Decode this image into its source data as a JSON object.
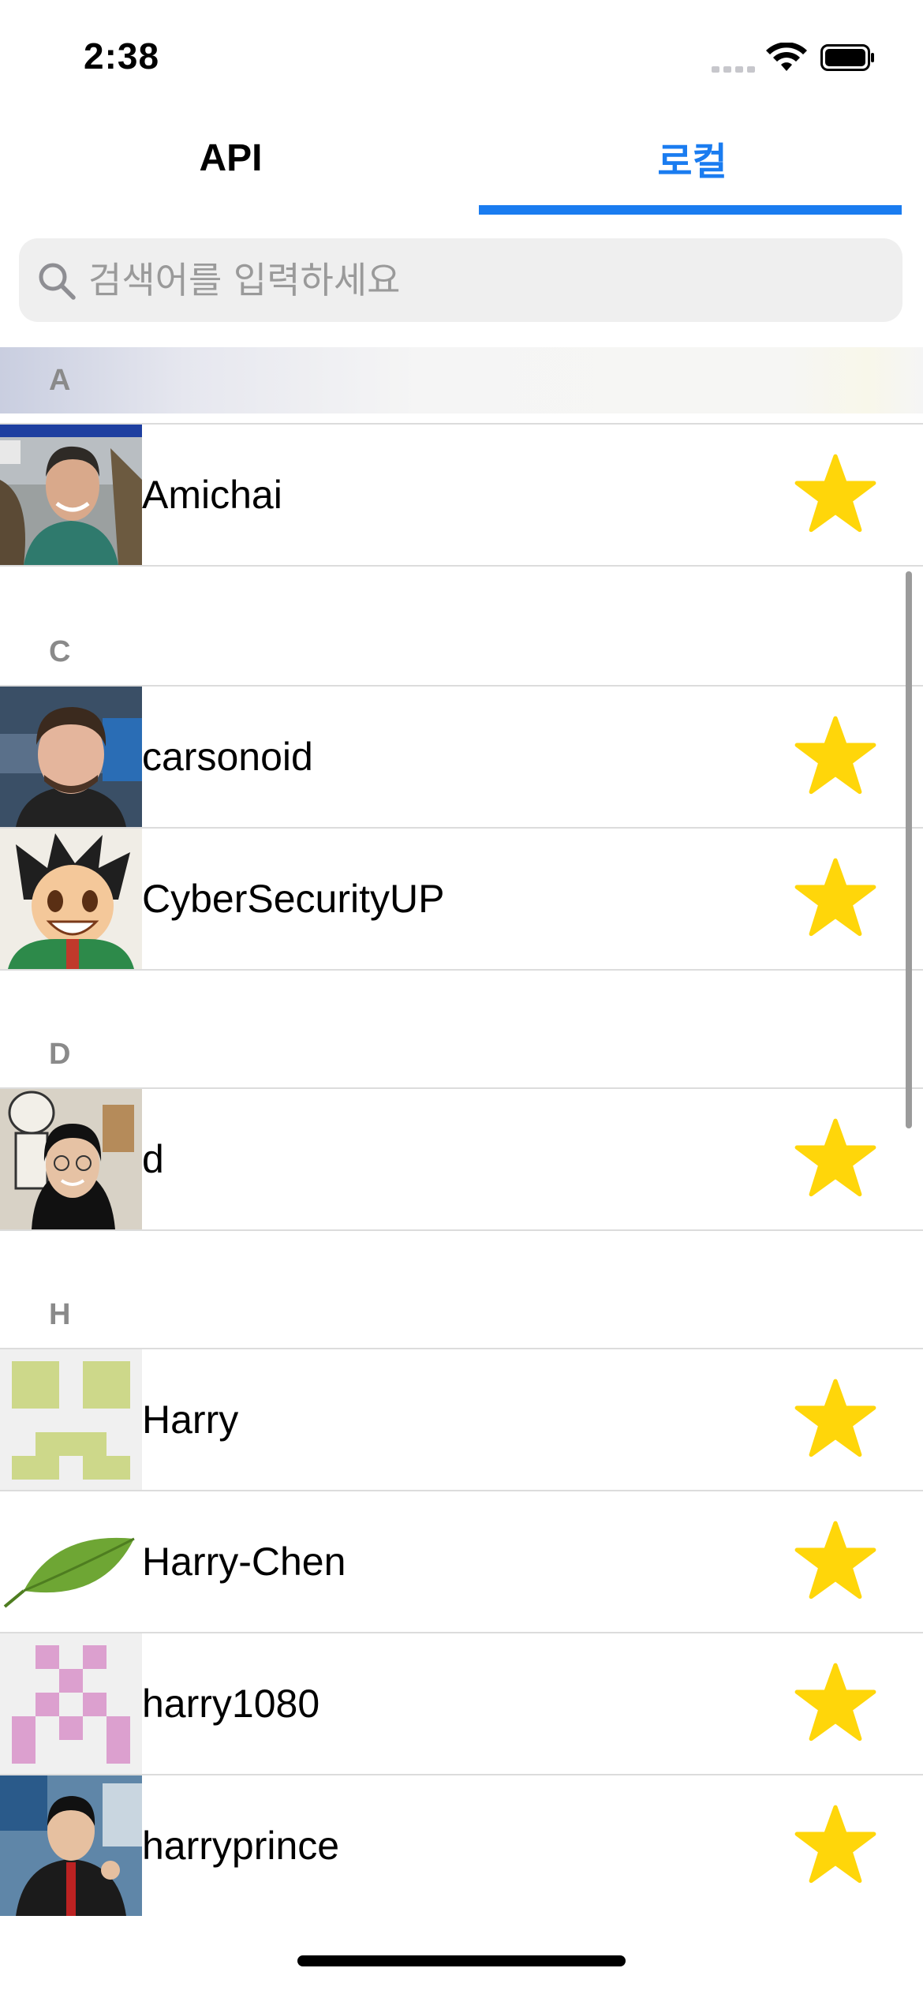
{
  "status_bar": {
    "time": "2:38"
  },
  "tabs": [
    {
      "label": "API",
      "selected": false
    },
    {
      "label": "로컬",
      "selected": true
    }
  ],
  "search": {
    "placeholder": "검색어를 입력하세요",
    "value": ""
  },
  "sections": [
    {
      "letter": "A",
      "users": [
        {
          "name": "Amichai",
          "favorite": true,
          "avatar": "photo-man-green-shirt"
        }
      ]
    },
    {
      "letter": "C",
      "users": [
        {
          "name": "carsonoid",
          "favorite": true,
          "avatar": "photo-man-dark-hair"
        },
        {
          "name": "CyberSecurityUP",
          "favorite": true,
          "avatar": "anime-boy-green-jacket"
        }
      ]
    },
    {
      "letter": "D",
      "users": [
        {
          "name": "d",
          "favorite": true,
          "avatar": "photo-woman-glasses"
        }
      ]
    },
    {
      "letter": "H",
      "users": [
        {
          "name": "Harry",
          "favorite": true,
          "avatar": "identicon-green"
        },
        {
          "name": "Harry-Chen",
          "favorite": true,
          "avatar": "green-leaf"
        },
        {
          "name": "harry1080",
          "favorite": true,
          "avatar": "identicon-pink"
        },
        {
          "name": "harryprince",
          "favorite": true,
          "avatar": "photo-young-man"
        }
      ]
    }
  ],
  "colors": {
    "accent": "#1a7cf0",
    "star": "#ffd60a",
    "section_text": "#8a8a8a",
    "divider": "#dcdcdc"
  },
  "icons": [
    "search-icon",
    "wifi-icon",
    "battery-icon",
    "cellular-signal-icon",
    "star-icon"
  ]
}
